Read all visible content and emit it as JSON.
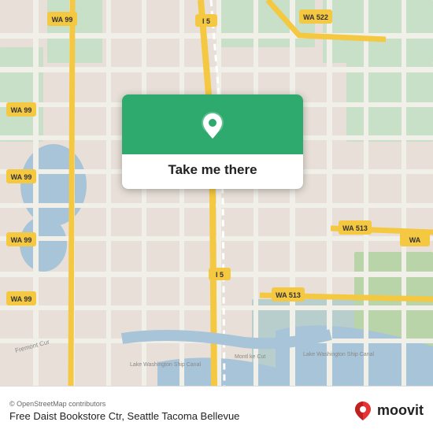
{
  "map": {
    "attribution": "© OpenStreetMap contributors",
    "background_color": "#e8e0d8"
  },
  "overlay": {
    "button_label": "Take me there",
    "pin_color": "#ffffff",
    "card_bg": "#2eaa6e"
  },
  "footer": {
    "attribution": "© OpenStreetMap contributors",
    "place_name": "Free Daist Bookstore Ctr, Seattle Tacoma Bellevue",
    "moovit_label": "moovit"
  },
  "roads": {
    "accent": "#f5c842",
    "major": "#ffffff",
    "minor": "#ede8e0"
  }
}
